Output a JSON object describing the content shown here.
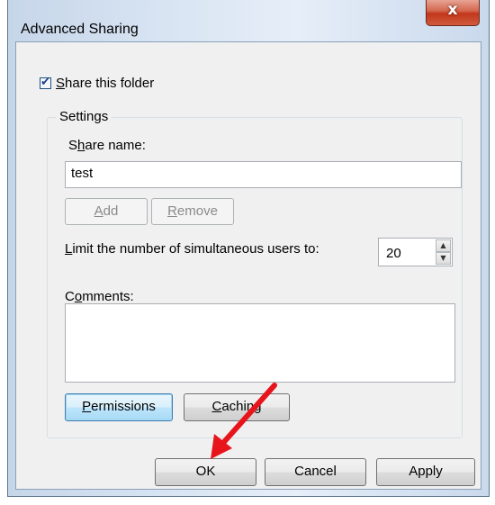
{
  "window": {
    "title": "Advanced Sharing",
    "close_glyph": "x"
  },
  "share": {
    "checkbox_label_mnemonic": "S",
    "checkbox_label_rest": "hare this folder",
    "checked": true,
    "check_glyph": "✔"
  },
  "settings": {
    "legend": "Settings",
    "share_name_label_pre": "S",
    "share_name_label_mnemonic": "h",
    "share_name_label_post": "are name:",
    "share_name_value": "test",
    "add_mnemonic": "A",
    "add_rest": "dd",
    "remove_mnemonic": "R",
    "remove_rest": "emove",
    "limit_label_mnemonic": "L",
    "limit_label_rest": "imit the number of simultaneous users to:",
    "limit_value": "20",
    "spin_up_glyph": "▲",
    "spin_down_glyph": "▼",
    "comments_label_pre": "C",
    "comments_label_mnemonic": "o",
    "comments_label_post": "mments:",
    "comments_value": "",
    "permissions_mnemonic": "P",
    "permissions_rest": "ermissions",
    "caching_mnemonic": "C",
    "caching_rest": "aching"
  },
  "footer": {
    "ok_label": "OK",
    "cancel_label": "Cancel",
    "apply_label": "Apply"
  },
  "annotation": {
    "arrow_color": "#e8141c"
  }
}
